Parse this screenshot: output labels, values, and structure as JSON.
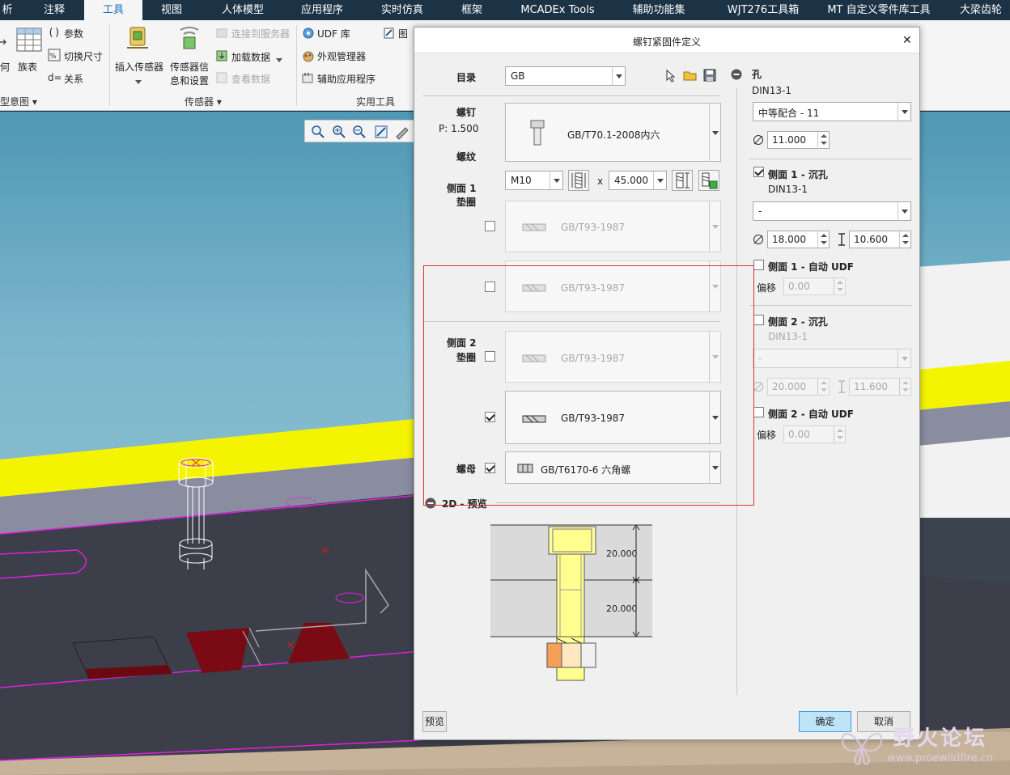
{
  "menu": {
    "tabs": [
      {
        "label": "析"
      },
      {
        "label": "注释"
      },
      {
        "label": "工具"
      },
      {
        "label": "视图"
      },
      {
        "label": "人体模型"
      },
      {
        "label": "应用程序"
      },
      {
        "label": "实时仿真"
      },
      {
        "label": "框架"
      },
      {
        "label": "MCADEx Tools"
      },
      {
        "label": "辅助功能集"
      },
      {
        "label": "WJT276工具箱"
      },
      {
        "label": "MT 自定义零件库工具"
      },
      {
        "label": "大梁齿轮"
      }
    ],
    "active_index": 2
  },
  "ribbon": {
    "model_intent": {
      "geometry_fragment": "何",
      "family_table": "族表",
      "parameters": "参数",
      "switch_dimensions": "切换尺寸",
      "relations": "关系",
      "group_label": "型意图"
    },
    "sensors": {
      "insert_sensor": "插入传感器",
      "sensor_info_1": "传感器信",
      "sensor_info_2": "息和设置",
      "connect_server": "连接到服务器",
      "load_data": "加载数据",
      "view_data": "查看数据",
      "group_label": "传感器"
    },
    "utilities": {
      "udf_library": "UDF 库",
      "appearance_manager": "外观管理器",
      "aux_applications": "辅助应用程序",
      "graphic_fragment": "图",
      "group_label": "实用工具"
    }
  },
  "dialog": {
    "title": "螺钉紧固件定义",
    "catalog_label": "目录",
    "catalog_value": "GB",
    "screw": {
      "label": "螺钉",
      "pitch": "P: 1.500",
      "thread_label": "螺纹",
      "standard": "GB/T70.1-2008内六",
      "size": "M10",
      "times": "x",
      "length": "45.000"
    },
    "side1": {
      "label": "侧面 1",
      "washer_label": "垫圈",
      "washer1": {
        "value": "GB/T93-1987",
        "checked": false
      },
      "washer2": {
        "value": "GB/T93-1987",
        "checked": false
      }
    },
    "side2": {
      "label": "侧面 2",
      "washer_label": "垫圈",
      "washer1": {
        "value": "GB/T93-1987",
        "checked": false
      },
      "washer2": {
        "value": "GB/T93-1987",
        "checked": true
      }
    },
    "nut": {
      "label": "螺母",
      "value": "GB/T6170-6 六角螺",
      "checked": true
    },
    "preview_section": "2D - 预览",
    "preview_dims": [
      "20.000",
      "20.000"
    ],
    "hole": {
      "title": "孔",
      "standard": "DIN13-1",
      "fit": "中等配合 - 11",
      "diameter": "11.000"
    },
    "side1_counterbore": {
      "label": "侧面 1 - 沉孔",
      "checked": true,
      "standard": "DIN13-1",
      "type": "-",
      "diameter": "18.000",
      "depth": "10.600"
    },
    "side1_udf": {
      "label": "侧面 1 - 自动 UDF",
      "checked": false,
      "offset_label": "偏移",
      "offset": "0.00"
    },
    "side2_counterbore": {
      "label": "侧面 2 - 沉孔",
      "checked": false,
      "standard": "DIN13-1",
      "type": "-",
      "diameter": "20.000",
      "depth": "11.600"
    },
    "side2_udf": {
      "label": "侧面 2 - 自动 UDF",
      "checked": false,
      "offset_label": "偏移",
      "offset": "0.00"
    },
    "buttons": {
      "preview": "预览",
      "ok": "确定",
      "cancel": "取消"
    }
  },
  "watermark": {
    "brand": "野火论坛",
    "url": "www.proewildfire.cn"
  },
  "colors": {
    "menubar": "#1c3345",
    "active_tab_text": "#1a6fc0",
    "highlight_box": "#e03030",
    "ok_button": "#bfe4f7",
    "model_yellow": "#f4f400",
    "model_magenta": "#e020e0"
  }
}
